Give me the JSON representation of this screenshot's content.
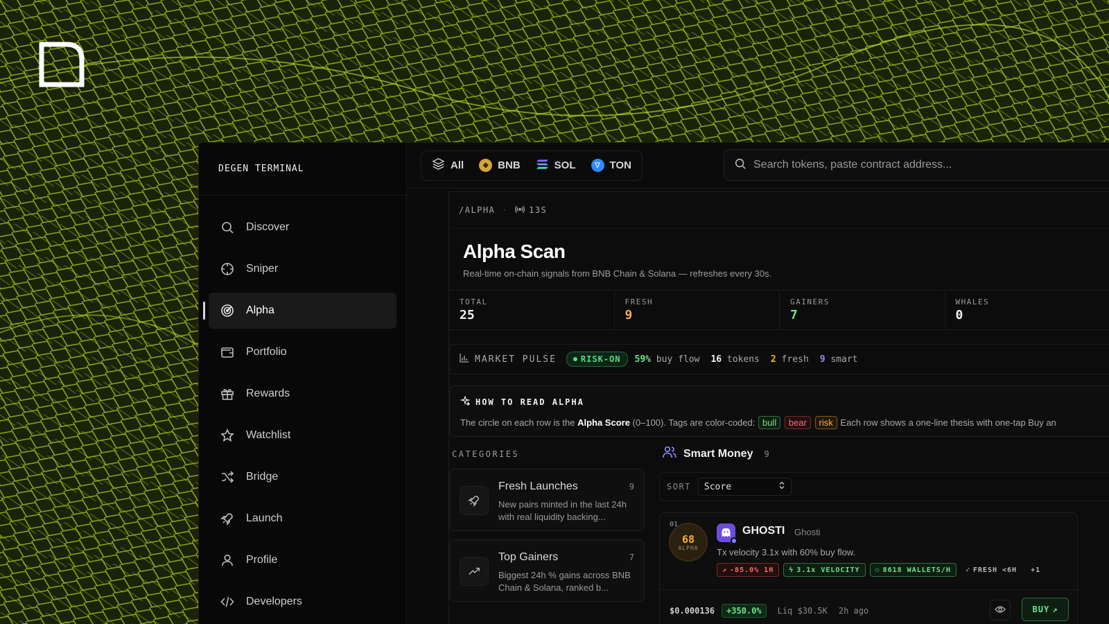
{
  "sidebar": {
    "brand": "DEGEN TERMINAL",
    "items": [
      {
        "label": "Discover",
        "icon": "search-icon"
      },
      {
        "label": "Sniper",
        "icon": "crosshair-icon"
      },
      {
        "label": "Alpha",
        "icon": "radar-icon",
        "active": true
      },
      {
        "label": "Portfolio",
        "icon": "wallet-icon"
      },
      {
        "label": "Rewards",
        "icon": "gift-icon"
      },
      {
        "label": "Watchlist",
        "icon": "star-icon"
      },
      {
        "label": "Bridge",
        "icon": "shuffle-icon"
      },
      {
        "label": "Launch",
        "icon": "rocket-icon"
      },
      {
        "label": "Profile",
        "icon": "user-icon"
      },
      {
        "label": "Developers",
        "icon": "code-icon"
      }
    ]
  },
  "chains": [
    {
      "label": "All",
      "icon": "layers-icon"
    },
    {
      "label": "BNB",
      "icon": "bnb-icon",
      "color": "#d4a43a"
    },
    {
      "label": "SOL",
      "icon": "solana-icon",
      "color": "#7a6bff"
    },
    {
      "label": "TON",
      "icon": "ton-icon",
      "color": "#2e8bff"
    }
  ],
  "search": {
    "placeholder": "Search tokens, paste contract address..."
  },
  "breadcrumb": {
    "path": "/ALPHA",
    "live": "13S"
  },
  "page": {
    "title": "Alpha Scan",
    "subtitle": "Real-time on-chain signals from BNB Chain & Solana — refreshes every 30s."
  },
  "stats": [
    {
      "label": "TOTAL",
      "value": "25",
      "color": "#f0f0f0"
    },
    {
      "label": "FRESH",
      "value": "9",
      "color": "#f2b04a"
    },
    {
      "label": "GAINERS",
      "value": "7",
      "color": "#6ee28a"
    },
    {
      "label": "WHALES",
      "value": "0",
      "color": "#f0f0f0"
    }
  ],
  "pulse": {
    "label": "MARKET PULSE",
    "status": "RISK-ON",
    "buy_flow_pct": "59%",
    "buy_flow_label": "buy flow",
    "tokens_n": "16",
    "tokens_label": "tokens",
    "fresh_n": "2",
    "fresh_label": "fresh",
    "smart_n": "9",
    "smart_label": "smart"
  },
  "howto": {
    "title": "HOW TO READ ALPHA",
    "text_a": "The circle on each row is the ",
    "text_b": "Alpha Score",
    "text_c": " (0–100). Tags are color-coded: ",
    "tag_bull": "bull",
    "tag_bear": "bear",
    "tag_risk": "risk",
    "text_d": " Each row shows a one-line thesis with one-tap Buy an"
  },
  "categories": {
    "heading": "CATEGORIES",
    "items": [
      {
        "title": "Fresh Launches",
        "count": "9",
        "desc": "New pairs minted in the last 24h with real liquidity backing..."
      },
      {
        "title": "Top Gainers",
        "count": "7",
        "desc": "Biggest 24h % gains across BNB Chain & Solana, ranked b..."
      }
    ]
  },
  "smart_money": {
    "title": "Smart Money",
    "count": "9",
    "sort_label": "SORT",
    "sort_value": "Score"
  },
  "row": {
    "index": "01",
    "score": "68",
    "score_label": "ALPHA",
    "symbol": "GHOSTI",
    "name": "Ghosti",
    "thesis": "Tx velocity 3.1x with 60% buy flow.",
    "badges": [
      {
        "text": "-85.0% 1H",
        "tone": "red"
      },
      {
        "text": "3.1x VELOCITY",
        "tone": "grn"
      },
      {
        "text": "8618 WALLETS/H",
        "tone": "grn"
      },
      {
        "text": "FRESH <6H",
        "tone": "gry"
      },
      {
        "text": "+1",
        "tone": "gry"
      }
    ],
    "price": "$0.000136",
    "change": "+350.0%",
    "liq": "Liq $30.5K",
    "age": "2h ago",
    "buy_label": "BUY"
  }
}
